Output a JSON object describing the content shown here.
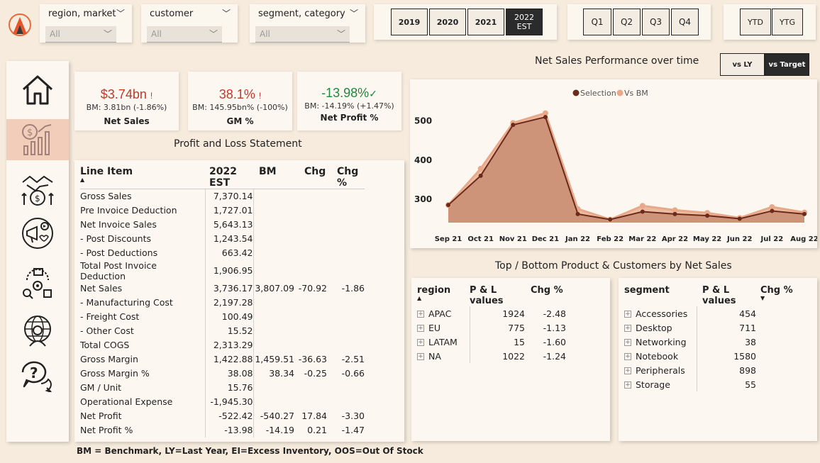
{
  "filters": [
    {
      "label": "region, market",
      "value": "All"
    },
    {
      "label": "customer",
      "value": "All"
    },
    {
      "label": "segment, category",
      "value": "All"
    }
  ],
  "years": [
    {
      "label": "2019",
      "selected": false
    },
    {
      "label": "2020",
      "selected": false
    },
    {
      "label": "2021",
      "selected": false
    },
    {
      "label": "2022\nEST",
      "selected": true
    }
  ],
  "quarters": [
    "Q1",
    "Q2",
    "Q3",
    "Q4"
  ],
  "periods": [
    "YTD",
    "YTG"
  ],
  "kpis": [
    {
      "value": "$3.74bn",
      "flag": "!",
      "bm": "BM: 3.81bn (-1.86%)",
      "name": "Net Sales",
      "color": "#c0392b"
    },
    {
      "value": "38.1%",
      "flag": "!",
      "bm": "BM: 145.95bn% (-100%)",
      "name": "GM %",
      "color": "#c0392b"
    },
    {
      "value": "-13.98%",
      "flag": "✓",
      "bm": "BM: -14.19% (+1.47%)",
      "name": "Net Profit %",
      "color": "#1e8a3c"
    }
  ],
  "pl_title": "Profit and Loss Statement",
  "pl_table": {
    "headers": [
      "Line Item",
      "2022 EST",
      "BM",
      "Chg",
      "Chg %"
    ],
    "rows": [
      [
        "Gross Sales",
        "7,370.14",
        "",
        "",
        ""
      ],
      [
        "Pre Invoice Deduction",
        "1,727.01",
        "",
        "",
        ""
      ],
      [
        "Net Invoice Sales",
        "5,643.13",
        "",
        "",
        ""
      ],
      [
        " - Post Discounts",
        "1,243.54",
        "",
        "",
        ""
      ],
      [
        " - Post Deductions",
        "663.42",
        "",
        "",
        ""
      ],
      [
        "Total Post Invoice Deduction",
        "1,906.95",
        "",
        "",
        ""
      ],
      [
        "Net Sales",
        "3,736.17",
        "3,807.09",
        "-70.92",
        "-1.86"
      ],
      [
        " - Manufacturing Cost",
        "2,197.28",
        "",
        "",
        ""
      ],
      [
        " - Freight Cost",
        "100.49",
        "",
        "",
        ""
      ],
      [
        " - Other Cost",
        "15.52",
        "",
        "",
        ""
      ],
      [
        "Total COGS",
        "2,313.29",
        "",
        "",
        ""
      ],
      [
        "Gross Margin",
        "1,422.88",
        "1,459.51",
        "-36.63",
        "-2.51"
      ],
      [
        "Gross Margin %",
        "38.08",
        "38.34",
        "-0.25",
        "-0.66"
      ],
      [
        "GM / Unit",
        "15.76",
        "",
        "",
        ""
      ],
      [
        "Operational Expense",
        "-1,945.30",
        "",
        "",
        ""
      ],
      [
        "Net Profit",
        "-522.42",
        "-540.27",
        "17.84",
        "-3.30"
      ],
      [
        "Net Profit %",
        "-13.98",
        "-14.19",
        "0.21",
        "-1.47"
      ]
    ]
  },
  "chart_title": "Net Sales Performance over time",
  "toggles": [
    {
      "label": "vs LY",
      "selected": false
    },
    {
      "label": "vs Target",
      "selected": true
    }
  ],
  "chart_data": {
    "type": "area",
    "x": [
      "Sep 21",
      "Oct 21",
      "Nov 21",
      "Dec 21",
      "Jan 22",
      "Feb 22",
      "Mar 22",
      "Apr 22",
      "May 22",
      "Jun 22",
      "Jul 22",
      "Aug 22"
    ],
    "yticks": [
      300,
      400,
      500
    ],
    "ylim": [
      240,
      570
    ],
    "series": [
      {
        "name": "Selection",
        "color": "#6b2a1a",
        "values": [
          285,
          360,
          490,
          510,
          262,
          248,
          268,
          262,
          258,
          250,
          270,
          262
        ]
      },
      {
        "name": "Vs BM",
        "color": "#e8a889",
        "values": [
          285,
          378,
          495,
          520,
          275,
          248,
          283,
          272,
          265,
          252,
          280,
          266
        ]
      }
    ],
    "legend": "top-center",
    "grid": false
  },
  "bottom_title": "Top / Bottom Product & Customers by Net Sales",
  "region_table": {
    "headers": [
      "region",
      "P & L values",
      "Chg %"
    ],
    "rows": [
      [
        "APAC",
        "1924",
        "-2.48"
      ],
      [
        "EU",
        "775",
        "-1.13"
      ],
      [
        "LATAM",
        "15",
        "-1.60"
      ],
      [
        "NA",
        "1022",
        "-1.24"
      ]
    ]
  },
  "segment_table": {
    "headers": [
      "segment",
      "P & L values",
      "Chg %"
    ],
    "rows": [
      [
        "Accessories",
        "454"
      ],
      [
        "Desktop",
        "711"
      ],
      [
        "Networking",
        "38"
      ],
      [
        "Notebook",
        "1580"
      ],
      [
        "Peripherals",
        "898"
      ],
      [
        "Storage",
        "55"
      ]
    ]
  },
  "footer": "BM = Benchmark, LY=Last Year, EI=Excess Inventory, OOS=Out Of Stock",
  "nav_icons": [
    "home-icon",
    "finance-icon",
    "customer-icon",
    "marketing-icon",
    "supply-chain-icon",
    "executive-icon",
    "help-icon"
  ]
}
